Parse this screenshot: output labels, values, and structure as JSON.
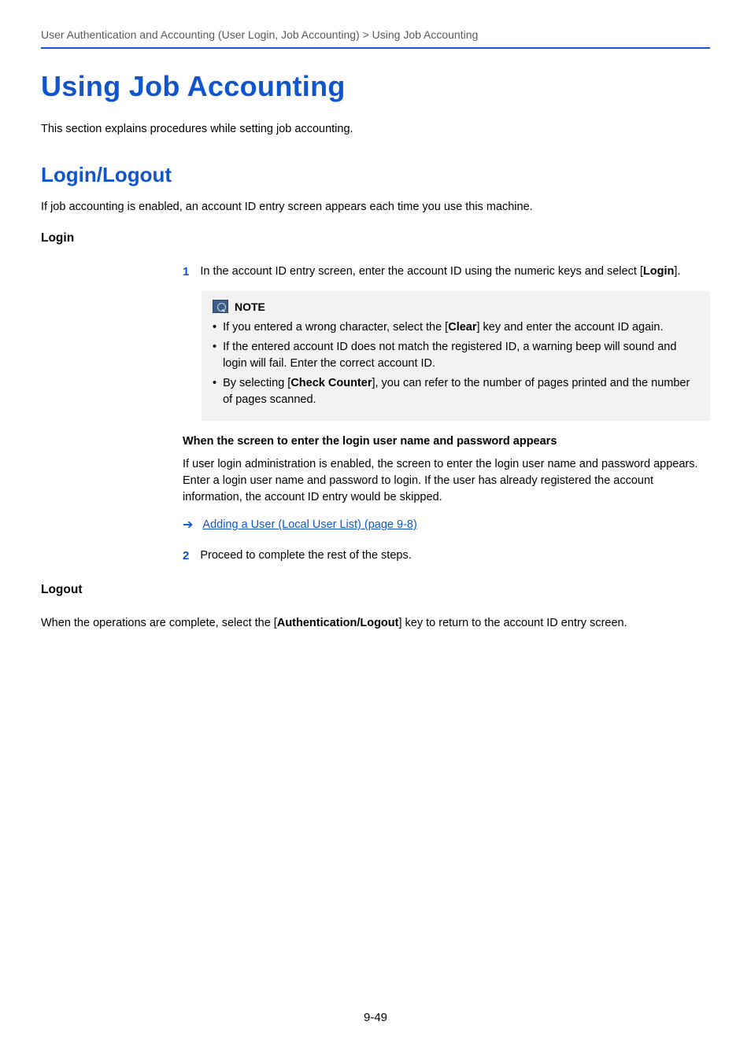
{
  "breadcrumb": "User Authentication and Accounting (User Login, Job Accounting) > Using Job Accounting",
  "h1": "Using Job Accounting",
  "intro": "This section explains procedures while setting job accounting.",
  "h2": "Login/Logout",
  "p_sub": "If job accounting is enabled, an account ID entry screen appears each time you use this machine.",
  "login": {
    "heading": "Login",
    "step1_num": "1",
    "step1_a": "In the account ID entry screen, enter the account ID using the numeric keys and select [",
    "step1_b": "Login",
    "step1_c": "].",
    "note_label": "NOTE",
    "n1a": "If you entered a wrong character, select the [",
    "n1b": "Clear",
    "n1c": "] key and enter the account ID again.",
    "n2": "If the entered account ID does not match the registered ID, a warning beep will sound and login will fail. Enter the correct account ID.",
    "n3a": "By selecting [",
    "n3b": "Check Counter",
    "n3c": "], you can refer to the number of pages printed and the number of pages scanned.",
    "subh": "When the screen to enter the login user name and password appears",
    "subp": "If user login administration is enabled, the screen to enter the login user name and password appears. Enter a login user name and password to login. If the user has already registered the account information, the account ID entry would be skipped.",
    "link": "Adding a User (Local User List) (page 9-8)",
    "step2_num": "2",
    "step2": "Proceed to complete the rest of the steps."
  },
  "logout": {
    "heading": "Logout",
    "p_a": "When the operations are complete, select the [",
    "p_b": "Authentication/Logout",
    "p_c": "] key to return to the account ID entry screen."
  },
  "page_number": "9-49"
}
